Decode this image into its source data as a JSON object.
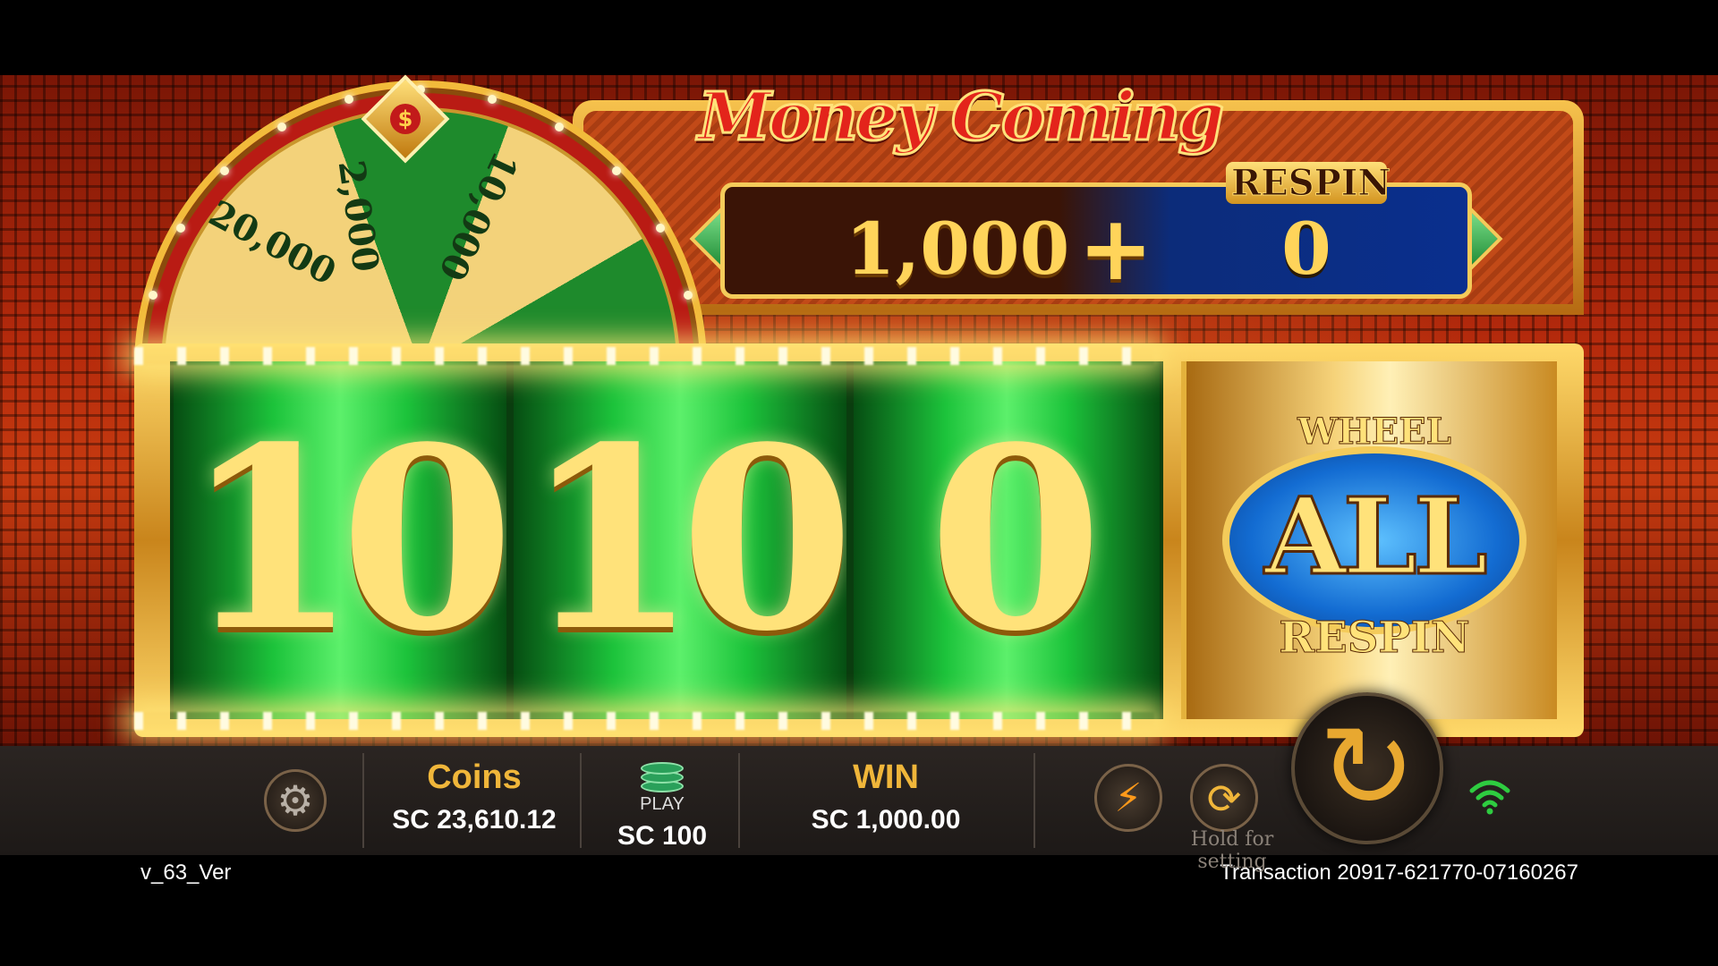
{
  "game": {
    "title": "Money Coming"
  },
  "wheel": {
    "pointer_symbol": "$",
    "segments": [
      "20,000",
      "2,000",
      "10,000"
    ]
  },
  "counter": {
    "value": "1,000",
    "plus": "+",
    "respin_label": "RESPIN",
    "respin_value": "0"
  },
  "reels": {
    "reel_1": "10",
    "reel_2": "10",
    "reel_3": "0",
    "bonus": {
      "line_1": "WHEEL",
      "line_2": "ALL",
      "line_3": "RESPIN"
    }
  },
  "bottom_bar": {
    "coins_label": "Coins",
    "coins_value": "SC 23,610.12",
    "play_label": "PLAY",
    "bet_value": "SC 100",
    "win_label": "WIN",
    "win_value": "SC 1,000.00",
    "hold_text": "Hold for setting",
    "icons": {
      "settings": "gear-icon",
      "turbo": "lightning-icon",
      "autoplay": "autoplay-icon",
      "spin": "spin-icon",
      "wifi": "wifi-icon"
    }
  },
  "footer": {
    "version": "v_63_Ver",
    "transaction": "Transaction 20917-621770-07160267"
  },
  "colors": {
    "accent_gold": "#f0b63a",
    "reel_green": "#1cc33b",
    "respin_blue": "#0a2f8e",
    "wifi_green": "#2ecc40"
  }
}
